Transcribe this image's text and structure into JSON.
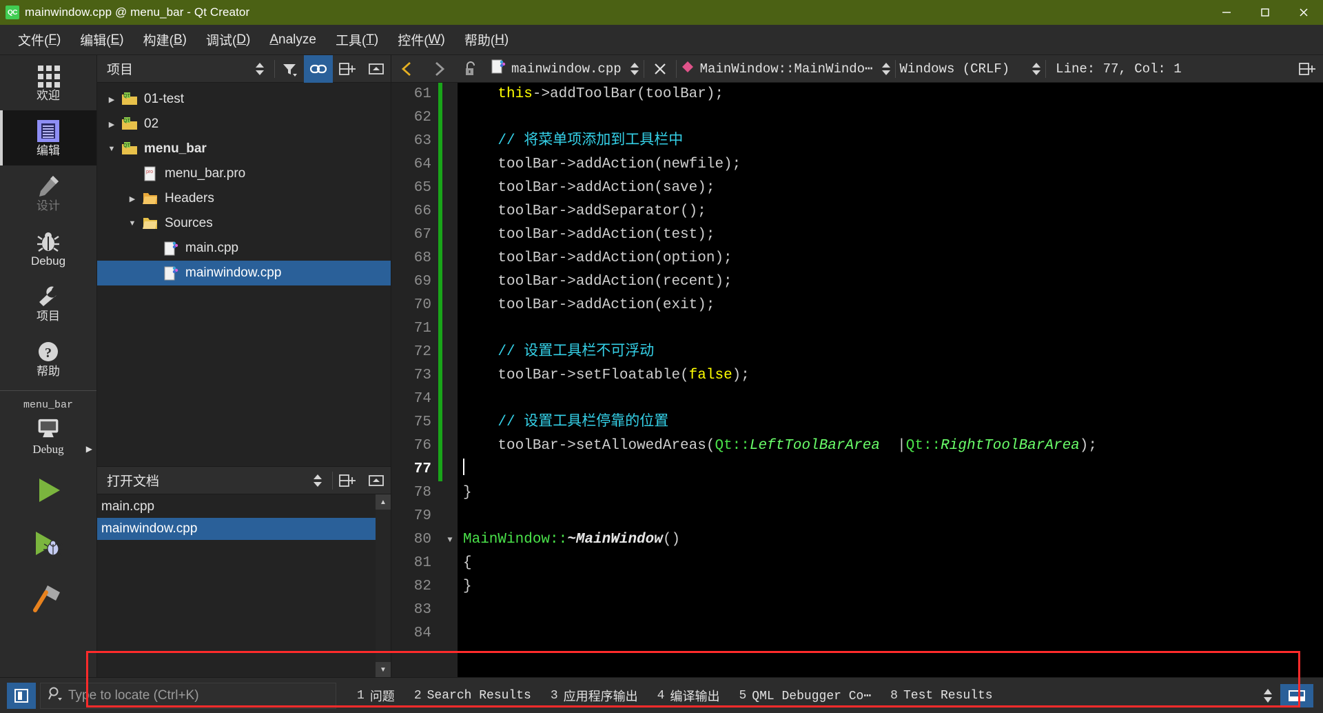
{
  "titlebar": {
    "logo": "QC",
    "title": "mainwindow.cpp @ menu_bar - Qt Creator",
    "minimize": "minimize-icon",
    "maximize": "maximize-icon",
    "close": "close-icon"
  },
  "menubar": {
    "items": [
      {
        "text": "文件",
        "mnemonic": "F"
      },
      {
        "text": "编辑",
        "mnemonic": "E"
      },
      {
        "text": "构建",
        "mnemonic": "B"
      },
      {
        "text": "调试",
        "mnemonic": "D"
      },
      {
        "text": "Analyze",
        "mnemonic": ""
      },
      {
        "text": "工具",
        "mnemonic": "T"
      },
      {
        "text": "控件",
        "mnemonic": "W"
      },
      {
        "text": "帮助",
        "mnemonic": "H"
      }
    ]
  },
  "modebar": {
    "modes": [
      {
        "label": "欢迎",
        "icon": "grid-icon",
        "active": false,
        "dim": false
      },
      {
        "label": "编辑",
        "icon": "document-lines-icon",
        "active": true,
        "dim": false
      },
      {
        "label": "设计",
        "icon": "pencil-icon",
        "active": false,
        "dim": true
      },
      {
        "label": "Debug",
        "icon": "bug-icon",
        "active": false,
        "dim": false
      },
      {
        "label": "项目",
        "icon": "wrench-icon",
        "active": false,
        "dim": false
      },
      {
        "label": "帮助",
        "icon": "question-circle-icon",
        "active": false,
        "dim": false
      }
    ],
    "kit_name": "menu_bar",
    "kit_target": "Debug",
    "kit_icon": "monitor-icon",
    "run_button": "run-icon",
    "debug_button": "run-debug-icon",
    "build_button": "hammer-icon"
  },
  "project_panel": {
    "title": "项目",
    "toolbar": {
      "sync_icon": "updown-arrows-icon",
      "filter_icon": "filter-icon",
      "link_icon": "link-with-editor-icon",
      "split_icon": "split-add-icon",
      "close_icon": "close-panel-icon"
    },
    "tree": [
      {
        "label": "01-test",
        "depth": 1,
        "twist": "collapsed",
        "icon": "project-icon",
        "bold": false,
        "selected": false
      },
      {
        "label": "02",
        "depth": 1,
        "twist": "collapsed",
        "icon": "project-icon",
        "bold": false,
        "selected": false
      },
      {
        "label": "menu_bar",
        "depth": 1,
        "twist": "expanded",
        "icon": "project-icon",
        "bold": true,
        "selected": false
      },
      {
        "label": "menu_bar.pro",
        "depth": 2,
        "twist": "none",
        "icon": "pro-file-icon",
        "bold": false,
        "selected": false
      },
      {
        "label": "Headers",
        "depth": 2,
        "twist": "collapsed",
        "icon": "folder-headers-icon",
        "bold": false,
        "selected": false
      },
      {
        "label": "Sources",
        "depth": 2,
        "twist": "expanded",
        "icon": "folder-sources-icon",
        "bold": false,
        "selected": false
      },
      {
        "label": "main.cpp",
        "depth": 3,
        "twist": "none",
        "icon": "cpp-file-icon",
        "bold": false,
        "selected": false
      },
      {
        "label": "mainwindow.cpp",
        "depth": 3,
        "twist": "none",
        "icon": "cpp-file-icon",
        "bold": false,
        "selected": true
      }
    ]
  },
  "open_documents": {
    "title": "打开文档",
    "toolbar": {
      "sync_icon": "updown-arrows-icon",
      "split_icon": "split-add-icon",
      "close_icon": "close-panel-icon"
    },
    "items": [
      {
        "label": "main.cpp",
        "selected": false
      },
      {
        "label": "mainwindow.cpp",
        "selected": true
      }
    ]
  },
  "editor_toolbar": {
    "back_icon": "chevron-left-icon",
    "forward_icon": "chevron-right-icon",
    "lock_icon": "unlocked-icon",
    "file_icon": "cpp-file-icon",
    "file_name": "mainwindow.cpp",
    "file_spin": "updown-arrows-icon",
    "close_icon": "close-document-icon",
    "symbol_marker": "diamond-icon",
    "symbol_color": "#e0538a",
    "symbol_name": "MainWindow::MainWindo⋯",
    "symbol_spin": "updown-arrows-icon",
    "line_ending": "Windows (CRLF)",
    "line_ending_spin": "updown-arrows-icon",
    "cursor_position": "Line: 77, Col: 1",
    "split_icon": "split-add-icon"
  },
  "editor": {
    "first_line": 61,
    "current_line": 77,
    "lines": [
      {
        "n": 61,
        "tokens": [
          {
            "t": "    ",
            "c": ""
          },
          {
            "t": "this",
            "c": "kw"
          },
          {
            "t": "->addToolBar(toolBar);",
            "c": ""
          }
        ]
      },
      {
        "n": 62,
        "tokens": []
      },
      {
        "n": 63,
        "tokens": [
          {
            "t": "    // 将菜单项添加到工具栏中",
            "c": "cmt"
          }
        ]
      },
      {
        "n": 64,
        "tokens": [
          {
            "t": "    toolBar->addAction(newfile);",
            "c": ""
          }
        ]
      },
      {
        "n": 65,
        "tokens": [
          {
            "t": "    toolBar->addAction(save);",
            "c": ""
          }
        ]
      },
      {
        "n": 66,
        "tokens": [
          {
            "t": "    toolBar->addSeparator();",
            "c": ""
          }
        ]
      },
      {
        "n": 67,
        "tokens": [
          {
            "t": "    toolBar->addAction(test);",
            "c": ""
          }
        ]
      },
      {
        "n": 68,
        "tokens": [
          {
            "t": "    toolBar->addAction(option);",
            "c": ""
          }
        ]
      },
      {
        "n": 69,
        "tokens": [
          {
            "t": "    toolBar->addAction(recent);",
            "c": ""
          }
        ]
      },
      {
        "n": 70,
        "tokens": [
          {
            "t": "    toolBar->addAction(exit);",
            "c": ""
          }
        ]
      },
      {
        "n": 71,
        "tokens": []
      },
      {
        "n": 72,
        "tokens": [
          {
            "t": "    // 设置工具栏不可浮动",
            "c": "cmt"
          }
        ]
      },
      {
        "n": 73,
        "tokens": [
          {
            "t": "    toolBar->setFloatable(",
            "c": ""
          },
          {
            "t": "false",
            "c": "kw"
          },
          {
            "t": ");",
            "c": ""
          }
        ]
      },
      {
        "n": 74,
        "tokens": []
      },
      {
        "n": 75,
        "tokens": [
          {
            "t": "    // 设置工具栏停靠的位置",
            "c": "cmt"
          }
        ]
      },
      {
        "n": 76,
        "tokens": [
          {
            "t": "    toolBar->setAllowedAreas(",
            "c": ""
          },
          {
            "t": "Qt::",
            "c": "typ"
          },
          {
            "t": "LeftToolBarArea",
            "c": "typi"
          },
          {
            "t": "  |",
            "c": ""
          },
          {
            "t": "Qt::",
            "c": "typ"
          },
          {
            "t": "RightToolBarArea",
            "c": "typi"
          },
          {
            "t": ");",
            "c": ""
          }
        ]
      },
      {
        "n": 77,
        "tokens": [],
        "cursor": true
      },
      {
        "n": 78,
        "tokens": [
          {
            "t": "}",
            "c": ""
          }
        ]
      },
      {
        "n": 79,
        "tokens": []
      },
      {
        "n": 80,
        "tokens": [
          {
            "t": "MainWindow::",
            "c": "typ"
          },
          {
            "t": "~MainWindow",
            "c": "fni"
          },
          {
            "t": "()",
            "c": ""
          }
        ],
        "fold": true
      },
      {
        "n": 81,
        "tokens": [
          {
            "t": "{",
            "c": ""
          }
        ]
      },
      {
        "n": 82,
        "tokens": [
          {
            "t": "}",
            "c": ""
          }
        ]
      },
      {
        "n": 83,
        "tokens": []
      },
      {
        "n": 84,
        "tokens": []
      }
    ]
  },
  "statusbar": {
    "locator_icon": "sidebar-toggle-icon",
    "search_icon": "magnifier-icon",
    "locator_placeholder": "Type to locate (Ctrl+K)",
    "output_panes": [
      {
        "num": "1",
        "label": "问题"
      },
      {
        "num": "2",
        "label": "Search Results"
      },
      {
        "num": "3",
        "label": "应用程序输出"
      },
      {
        "num": "4",
        "label": "编译输出"
      },
      {
        "num": "5",
        "label": "QML Debugger Co⋯"
      },
      {
        "num": "8",
        "label": "Test Results"
      }
    ],
    "pane_spin": "updown-arrows-icon",
    "maximize_icon": "maximize-output-icon"
  },
  "colors": {
    "titlebar": "#4b6114",
    "accent_blue": "#2a6099",
    "highlight_red": "#ff2b2b",
    "green_run": "#7bb53e",
    "current_line_marker": "#19a519"
  }
}
